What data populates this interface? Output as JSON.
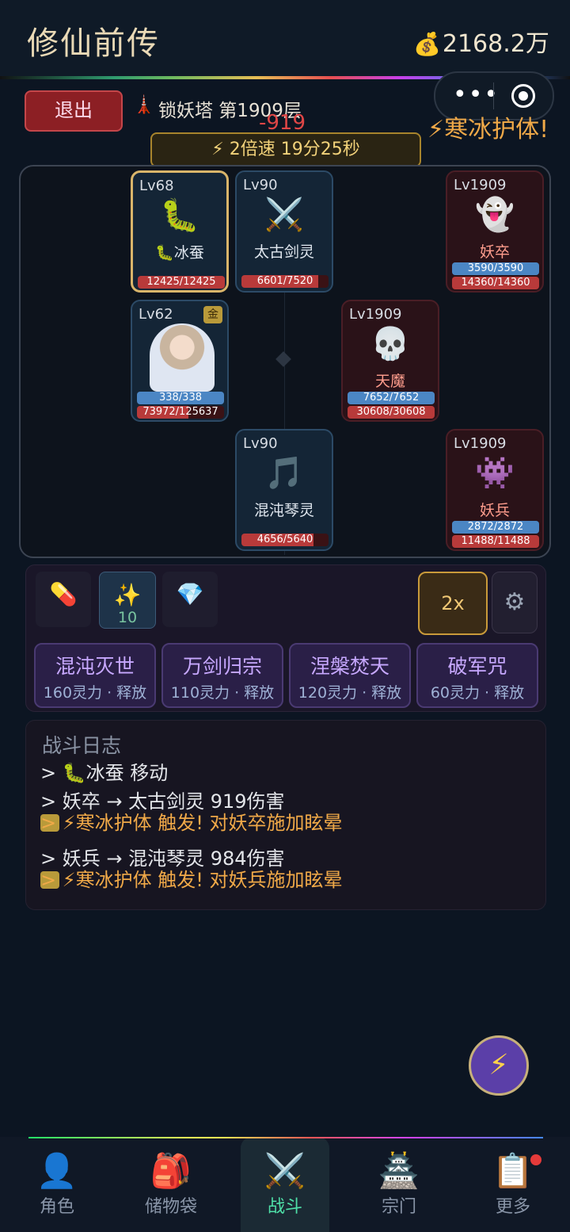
{
  "header": {
    "title": "修仙前传",
    "money": "2168.2万",
    "money_icon": "money-bag-icon"
  },
  "battle": {
    "exit_label": "退出",
    "location": "锁妖塔 第1909层",
    "damage_popup": "-919",
    "buff_popup": "⚡寒冰护体!",
    "speed_text": "⚡ 2倍速 19分25秒"
  },
  "units": {
    "silkworm": {
      "level": "Lv68",
      "name": "🐛冰蚕",
      "hp": "12425/12425",
      "hp_frac": 1.0
    },
    "sword": {
      "level": "Lv90",
      "name": "太古剑灵",
      "hp": "6601/7520",
      "hp_frac": 0.878
    },
    "hero": {
      "level": "Lv62",
      "badge": "金",
      "mp": "338/338",
      "mp_frac": 1.0,
      "hp": "73972/125637",
      "hp_frac": 0.589
    },
    "music": {
      "level": "Lv90",
      "name": "混沌琴灵",
      "hp": "4656/5640",
      "hp_frac": 0.826
    },
    "enemy1": {
      "level": "Lv1909",
      "name": "妖卒",
      "mp": "3590/3590",
      "mp_frac": 1.0,
      "hp": "14360/14360",
      "hp_frac": 1.0
    },
    "enemy2": {
      "level": "Lv1909",
      "name": "天魔",
      "mp": "7652/7652",
      "mp_frac": 1.0,
      "hp": "30608/30608",
      "hp_frac": 1.0
    },
    "enemy3": {
      "level": "Lv1909",
      "name": "妖兵",
      "mp": "2872/2872",
      "mp_frac": 1.0,
      "hp": "11488/11488",
      "hp_frac": 1.0
    }
  },
  "controls": {
    "item_count": "10",
    "speed_label": "2x",
    "skills": [
      {
        "name": "混沌灭世",
        "cost": "160灵力 · 释放"
      },
      {
        "name": "万剑归宗",
        "cost": "110灵力 · 释放"
      },
      {
        "name": "涅槃焚天",
        "cost": "120灵力 · 释放"
      },
      {
        "name": "破军咒",
        "cost": "60灵力 · 释放"
      }
    ]
  },
  "log": {
    "title": "战斗日志",
    "lines": [
      "> 🐛冰蚕 移动",
      "> 妖卒 → 太古剑灵 919伤害",
      "> ⚡寒冰护体 触发! 对妖卒施加眩晕",
      "> 妖兵 → 混沌琴灵 984伤害",
      "> ⚡寒冰护体 触发! 对妖兵施加眩晕"
    ]
  },
  "nav": [
    {
      "label": "角色",
      "icon": "person-icon"
    },
    {
      "label": "储物袋",
      "icon": "backpack-icon"
    },
    {
      "label": "战斗",
      "icon": "crossed-swords-icon"
    },
    {
      "label": "宗门",
      "icon": "pagoda-icon"
    },
    {
      "label": "更多",
      "icon": "clipboard-icon"
    }
  ],
  "colors": {
    "hp": "#b83a3a",
    "mp": "#4b86c4",
    "accent": "#f0a948",
    "active_nav": "#4fe0a8"
  }
}
